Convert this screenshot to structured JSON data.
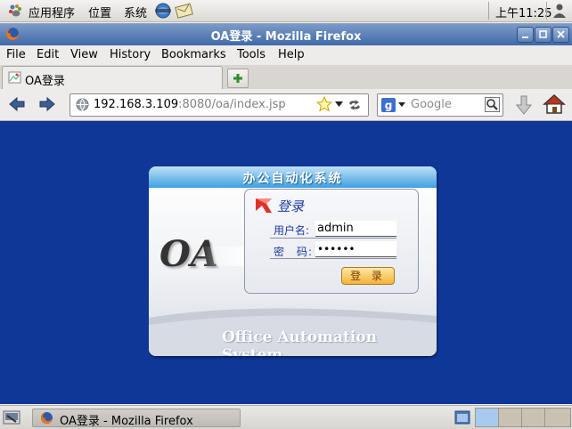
{
  "top_panel": {
    "menus": [
      "应用程序",
      "位置",
      "系统"
    ],
    "clock": "上午11:25"
  },
  "window": {
    "title": "OA登录 - Mozilla Firefox",
    "buttons": [
      "minimize",
      "maximize",
      "close"
    ]
  },
  "menubar": {
    "items": [
      "File",
      "Edit",
      "View",
      "History",
      "Bookmarks",
      "Tools",
      "Help"
    ]
  },
  "tabs": [
    {
      "title": "OA登录"
    }
  ],
  "navbar": {
    "url_host": "192.168.3.109",
    "url_rest": ":8080/oa/index.jsp",
    "search_placeholder": "Google"
  },
  "page": {
    "header": "办公自动化系统",
    "logo_text": "OA",
    "login_title": "登录",
    "username_label": "用户名:",
    "username_value": "admin",
    "password_label": "密　码:",
    "password_mask": "••••••",
    "login_button": "登 录",
    "footer": "Office Automation System"
  },
  "taskbar": {
    "task_label": "OA登录 - Mozilla Firefox"
  },
  "colors": {
    "page_bg": "#0f3797",
    "titlebar": "#3f6aa7",
    "panel_header": "#3fa0e0",
    "login_button": "#f3b33a"
  }
}
